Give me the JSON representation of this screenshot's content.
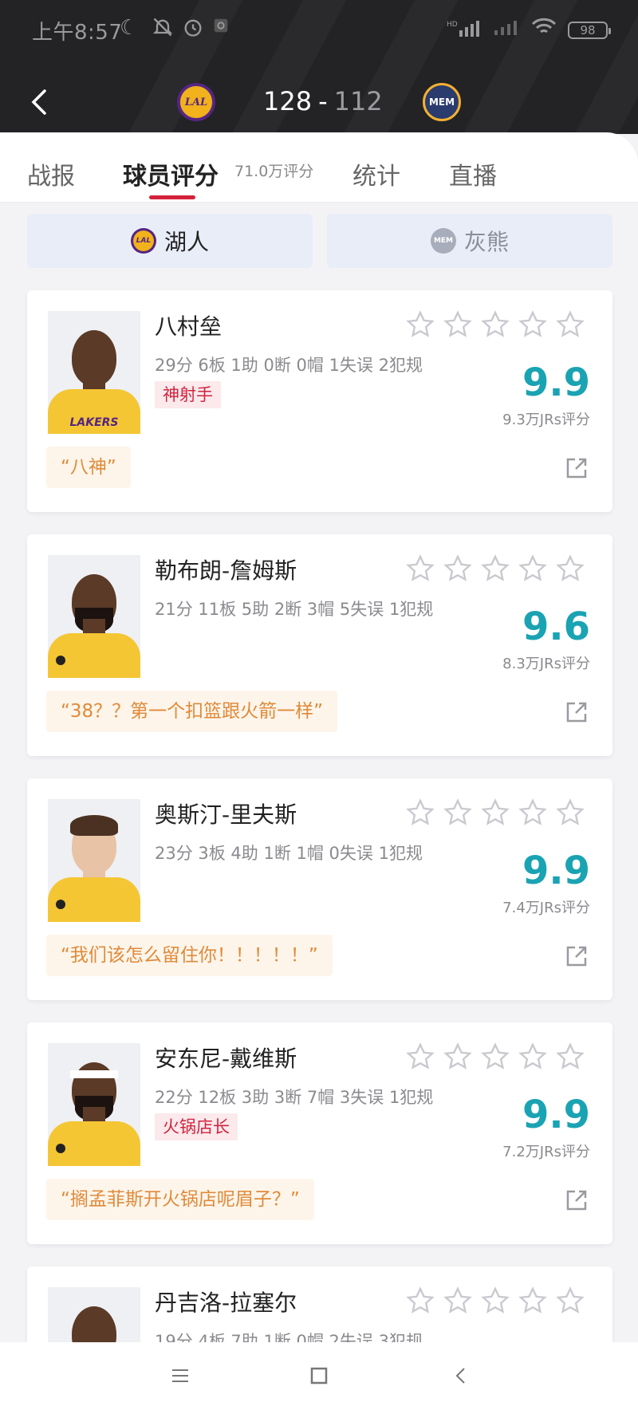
{
  "status_bar": {
    "time": "上午8:57",
    "battery": "98",
    "network": "HD"
  },
  "header": {
    "home_team_logo": "LAL",
    "away_team_logo": "MEM",
    "home_score": "128",
    "separator": "-",
    "away_score": "112"
  },
  "tabs": [
    {
      "label": "战报"
    },
    {
      "label": "球员评分",
      "sub": "71.0万评分"
    },
    {
      "label": "统计"
    },
    {
      "label": "直播"
    }
  ],
  "team_switch": {
    "home": "湖人",
    "away": "灰熊"
  },
  "players": [
    {
      "name": "八村垒",
      "stats": "29分 6板 1助 0断 0帽 1失误 2犯规",
      "tag": "神射手",
      "score": "9.9",
      "votes": "9.3万JRs评分",
      "quote": "“八神”",
      "jersey_text": "LAKERS"
    },
    {
      "name": "勒布朗-詹姆斯",
      "stats": "21分 11板 5助 2断 3帽 5失误 1犯规",
      "tag": "",
      "score": "9.6",
      "votes": "8.3万JRs评分",
      "quote": "“38？？第一个扣篮跟火箭一样”"
    },
    {
      "name": "奥斯汀-里夫斯",
      "stats": "23分 3板 4助 1断 1帽 0失误 1犯规",
      "tag": "",
      "score": "9.9",
      "votes": "7.4万JRs评分",
      "quote": "“我们该怎么留住你！！！！！”"
    },
    {
      "name": "安东尼-戴维斯",
      "stats": "22分 12板 3助 3断 7帽 3失误 1犯规",
      "tag": "火锅店长",
      "score": "9.9",
      "votes": "7.2万JRs评分",
      "quote": "“搁孟菲斯开火锅店呢眉子？”"
    },
    {
      "name": "丹吉洛-拉塞尔",
      "stats": "19分 4板 7助 1断 0帽 2失误 3犯规"
    }
  ]
}
